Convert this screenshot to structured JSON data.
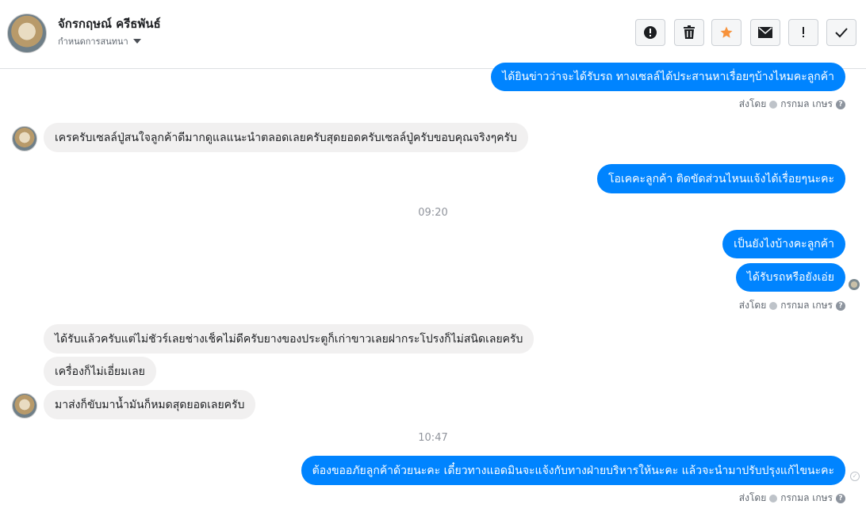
{
  "header": {
    "contact_name": "จักรกฤษณ์ ครีธพันธ์",
    "subtitle": "กำหนดการสนทนา",
    "avatar_icon": "profile-photo-icon"
  },
  "toolbar": {
    "buttons": [
      {
        "icon": "alert-circle-icon",
        "glyph": "!"
      },
      {
        "icon": "trash-icon",
        "glyph": "🗑"
      },
      {
        "icon": "star-icon",
        "glyph": "★",
        "color": "#f7923b"
      },
      {
        "icon": "envelope-icon",
        "glyph": "✉"
      },
      {
        "icon": "exclamation-icon",
        "glyph": "!"
      },
      {
        "icon": "checkmark-icon",
        "glyph": "✓"
      }
    ]
  },
  "messages": [
    {
      "dir": "out",
      "text": "ได้ยินข่าวว่าจะได้รับรถ ทางเซลล์ได้ประสานหาเรื่อยๆบ้างไหมคะลูกค้า"
    },
    {
      "dir": "in",
      "text": "เครครับเซลล์ปู่สนใจลูกค้าดีมากดูแลแนะนำตลอดเลยครับสุดยอดครับเซลล์ปู่ครับขอบคุณจริงๆครับ"
    },
    {
      "dir": "out",
      "text": "โอเคคะลูกค้า ติดขัดส่วนไหนแจ้งได้เรื่อยๆนะคะ"
    },
    {
      "dir": "out",
      "text": "เป็นยังไงบ้างคะลูกค้า"
    },
    {
      "dir": "out",
      "text": "ได้รับรถหรือยังเอ่ย"
    },
    {
      "dir": "in",
      "text": "ได้รับแล้วครับแต่ไม่ชัวร์เลยช่างเช็คไม่ดีครับยางของประตูก็เก่าขาวเลยฝากระโปรงก็ไม่สนิดเลยครับ"
    },
    {
      "dir": "in",
      "text": "เครื่องก็ไม่เอี่ยมเลย"
    },
    {
      "dir": "in",
      "text": "มาส่งก็ขับมาน้ำมันก็หมดสุดยอดเลยครับ"
    },
    {
      "dir": "out",
      "text": "ต้องขออภัยลูกค้าด้วยนะคะ เดี๋ยวทางแอดมินจะแจ้งกับทางฝ่ายบริหารให้นะคะ แล้วจะนำมาปรับปรุงแก้ไขนะคะ"
    }
  ],
  "sent_by": {
    "prefix": "ส่งโดย",
    "name": "กรกมล เกษร"
  },
  "timestamps": [
    "09:20",
    "10:47"
  ],
  "colors": {
    "outgoing": "#0084ff",
    "incoming": "#f1f0f0",
    "accent_star": "#f7923b"
  }
}
